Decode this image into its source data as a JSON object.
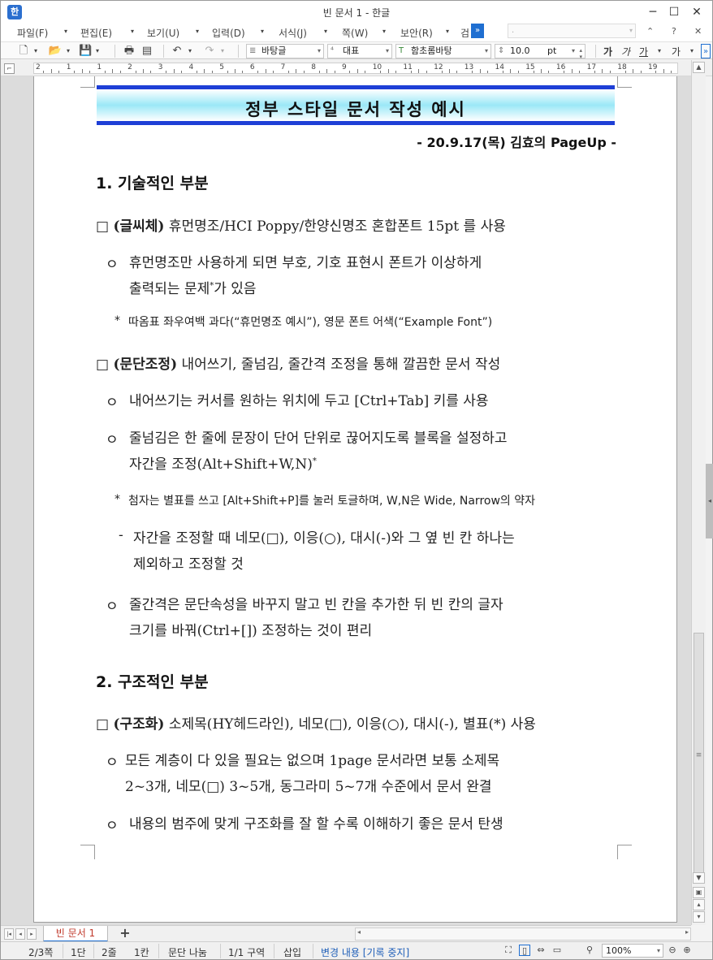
{
  "window": {
    "title": "빈 문서 1 - 한글",
    "app_icon": "한",
    "controls": {
      "minimize": "─",
      "maximize": "☐",
      "close": "✕"
    }
  },
  "menubar": {
    "items": [
      {
        "label": "파일(F)"
      },
      {
        "label": "편집(E)"
      },
      {
        "label": "보기(U)"
      },
      {
        "label": "입력(D)"
      },
      {
        "label": "서식(J)"
      },
      {
        "label": "쪽(W)"
      },
      {
        "label": "보안(R)"
      },
      {
        "label": "검"
      }
    ],
    "expand_label": "»",
    "style_combo_value": ".",
    "right": {
      "up": "⌃",
      "help": "?",
      "close": "✕"
    }
  },
  "toolbar": {
    "style_combo": "바탕글",
    "font_lang_combo": "대표",
    "font_combo": "함초롬바탕",
    "size_combo": "10.0",
    "size_unit": "pt",
    "format": {
      "bold": "가",
      "italic": "가",
      "underline": "가",
      "strike": "가"
    }
  },
  "ruler": {
    "numbers": [
      "2",
      "1",
      "1",
      "2",
      "3",
      "4",
      "5",
      "6",
      "7",
      "8",
      "9",
      "10",
      "11",
      "12",
      "13",
      "14",
      "15",
      "16",
      "17",
      "18",
      "19"
    ]
  },
  "document": {
    "title": "정부 스타일 문서 작성 예시",
    "date": "- 20.9.17(목) 김효의 PageUp -",
    "section1": "1. 기술적인 부분",
    "sq1_label": "(글씨체)",
    "sq1_text": " 휴먼명조/HCI Poppy/한양신명조 혼합폰트 15pt 를 사용",
    "c1_line1": "휴먼명조만 사용하게 되면 부호, 기호 표현시 폰트가 이상하게",
    "c1_line2": "출력되는 문제",
    "c1_line2_tail": "가 있음",
    "note1": "따옴표 좌우여백 과다(“휴먼명조 예시”), 영문 폰트 어색(“Example Font”)",
    "sq2_label": "(문단조정)",
    "sq2_text": " 내어쓰기, 줄넘김, 줄간격 조정을 통해 깔끔한 문서 작성",
    "c2": "내어쓰기는 커서를 원하는 위치에 두고 [Ctrl+Tab] 키를 사용",
    "c3_line1": "줄넘김은 한 줄에 문장이 단어 단위로 끊어지도록 블록을 설정하고",
    "c3_line2": "자간을 조정(Alt+Shift+W,N)",
    "note2": "첨자는 별표를 쓰고 [Alt+Shift+P]를 눌러 토글하며, W,N은 Wide, Narrow의 약자",
    "d1_line1": "자간을 조정할 때 네모(□), 이응(○), 대시(-)와 그 옆 빈 칸 하나는",
    "d1_line2": "제외하고 조정할 것",
    "c4_line1": "줄간격은 문단속성을 바꾸지 말고 빈 칸을 추가한 뒤 빈 칸의 글자",
    "c4_line2": "크기를 바꿔(Ctrl+[]) 조정하는 것이 편리",
    "section2": "2. 구조적인 부분",
    "sq3_label": "(구조화)",
    "sq3_text": " 소제목(HY헤드라인), 네모(□), 이응(○), 대시(-), 별표(*) 사용",
    "c5_line1": "모든 계층이 다 있을 필요는 없으며 1page 문서라면 보통 소제목",
    "c5_line2": "2~3개, 네모(□) 3~5개, 동그라미 5~7개 수준에서 문서 완결",
    "c6": "내용의 범주에 맞게 구조화를 잘 할 수록 이해하기 좋은 문서 탄생",
    "sym_square": "□",
    "sym_circle": "ㅇ",
    "sym_star": "*",
    "sym_dash": "-"
  },
  "tabs": {
    "doc_tab": "빈 문서 1",
    "add": "+"
  },
  "statusbar": {
    "page": "2/3쪽",
    "column": "1단",
    "line": "2줄",
    "col": "1칸",
    "break": "문단 나눔",
    "section": "1/1 구역",
    "mode": "삽입",
    "track": "변경 내용 [기록 중지]",
    "zoom": "100%"
  }
}
